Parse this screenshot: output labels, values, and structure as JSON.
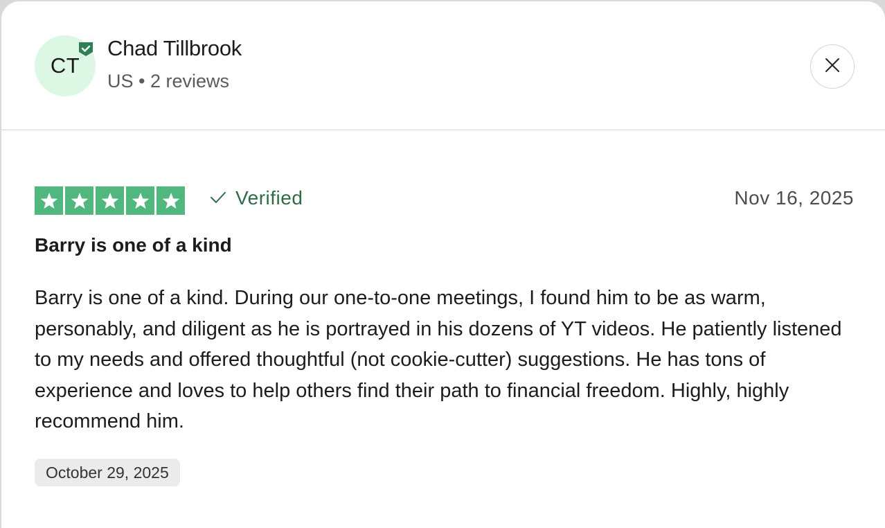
{
  "reviewer": {
    "initials": "CT",
    "name": "Chad Tillbrook",
    "meta": "US • 2 reviews"
  },
  "review": {
    "rating": 5,
    "rating_max": 5,
    "verified_label": "Verified",
    "date": "Nov 16, 2025",
    "title": "Barry is one of a kind",
    "text": "Barry is one of a kind. During our one-to-one meetings, I found him to be as warm, personably, and diligent as he is portrayed in his dozens of YT videos. He patiently listened to my needs and offered thoughtful (not cookie-cutter) suggestions. He has tons of experience and loves to help others find their path to financial freedom. Highly, highly recommend him.",
    "experience_date": "October 29, 2025"
  },
  "colors": {
    "star_green": "#51b77e",
    "verified_green": "#2f6b45",
    "avatar_bg": "#dcf7e4",
    "badge_green": "#2f7f56"
  }
}
